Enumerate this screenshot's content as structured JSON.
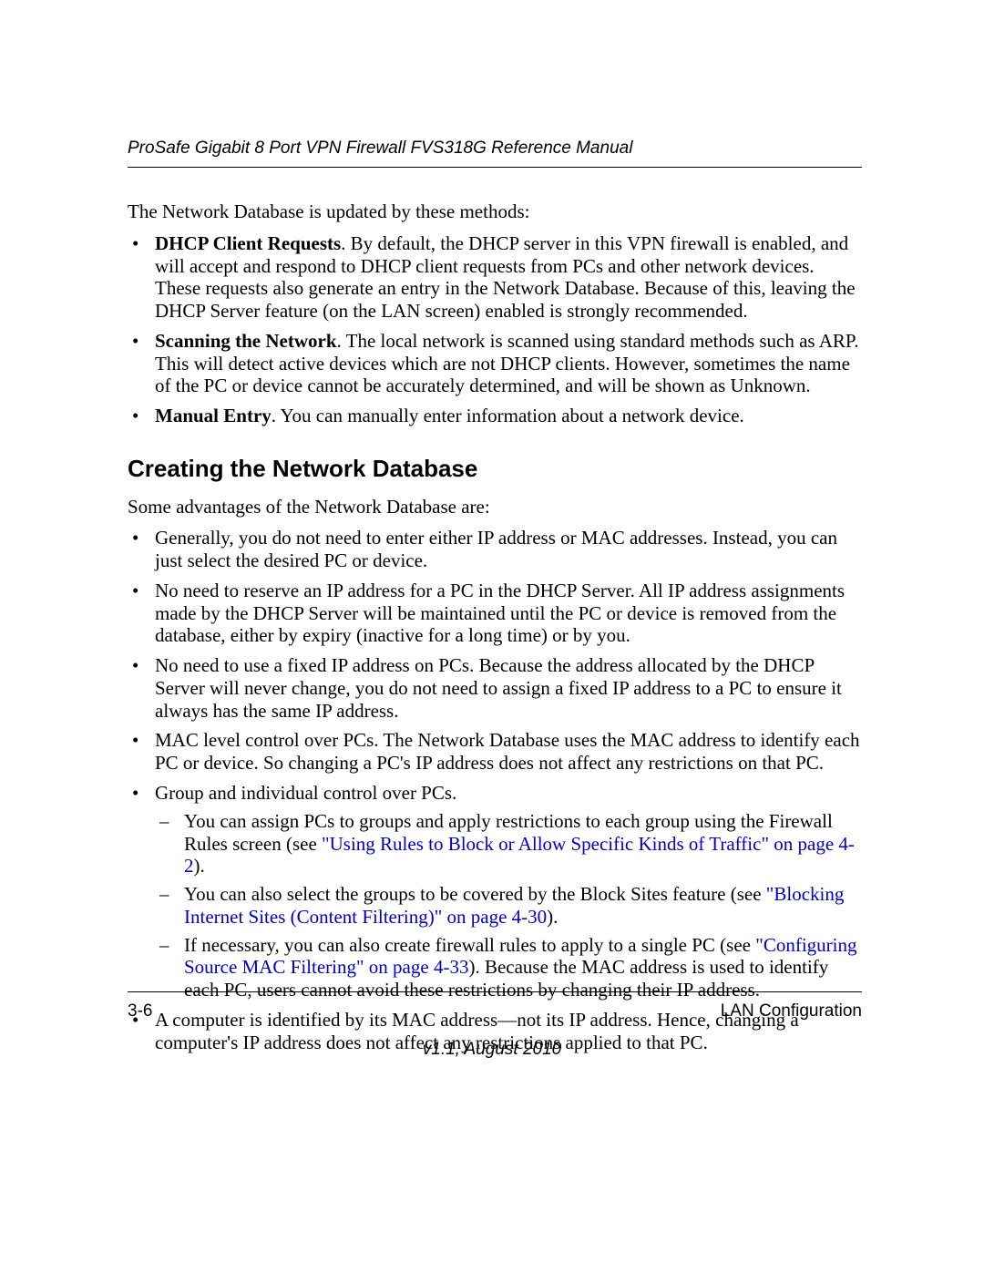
{
  "header": {
    "running_head": "ProSafe Gigabit 8 Port VPN Firewall FVS318G Reference Manual"
  },
  "intro": "The Network Database is updated by these methods:",
  "methods": [
    {
      "title": "DHCP Client Requests",
      "text": ". By default, the DHCP server in this VPN firewall is enabled, and will accept and respond to DHCP client requests from PCs and other network devices. These requests also generate an entry in the Network Database. Because of this, leaving the DHCP Server feature (on the LAN screen) enabled is strongly recommended."
    },
    {
      "title": "Scanning the Network",
      "text": ". The local network is scanned using standard methods such as ARP. This will detect active devices which are not DHCP clients. However, sometimes the name of the PC or device cannot be accurately determined, and will be shown as Unknown."
    },
    {
      "title": "Manual Entry",
      "text": ". You can manually enter information about a network device."
    }
  ],
  "section": {
    "heading": "Creating the Network Database",
    "intro": "Some advantages of the Network Database are:"
  },
  "advantages": {
    "a1": "Generally, you do not need to enter either IP address or MAC addresses. Instead, you can just select the desired PC or device.",
    "a2": "No need to reserve an IP address for a PC in the DHCP Server. All IP address assignments made by the DHCP Server will be maintained until the PC or device is removed from the database, either by expiry (inactive for a long time) or by you.",
    "a3": "No need to use a fixed IP address on PCs. Because the address allocated by the DHCP Server will never change, you do not need to assign a fixed IP address to a PC to ensure it always has the same IP address.",
    "a4": "MAC level control over PCs. The Network Database uses the MAC address to identify each PC or device. So changing a PC's IP address does not affect any restrictions on that PC.",
    "a5": "Group and individual control over PCs.",
    "a5_sub": {
      "s1_pre": "You can assign PCs to groups and apply restrictions to each group using the Firewall Rules screen (see ",
      "s1_link": "\"Using Rules to Block or Allow Specific Kinds of Traffic\" on page 4-2",
      "s1_post": ").",
      "s2_pre": "You can also select the groups to be covered by the Block Sites feature (see ",
      "s2_link": "\"Blocking Internet Sites (Content Filtering)\" on page 4-30",
      "s2_post": ").",
      "s3_pre": "If necessary, you can also create firewall rules to apply to a single PC (see ",
      "s3_link": "\"Configuring Source MAC Filtering\" on page 4-33",
      "s3_post": "). Because the MAC address is used to identify each PC, users cannot avoid these restrictions by changing their IP address."
    },
    "a6": "A computer is identified by its MAC address—not its IP address. Hence, changing a computer's IP address does not affect any restrictions applied to that PC."
  },
  "footer": {
    "page_number": "3-6",
    "section_name": "LAN Configuration",
    "version": "v1.1, August 2010"
  }
}
